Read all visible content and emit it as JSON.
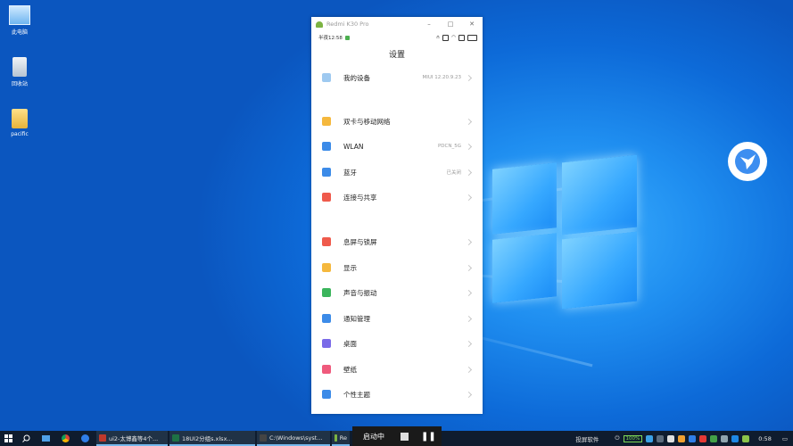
{
  "desktop": {
    "icons": [
      {
        "label": "此电脑"
      },
      {
        "label": "回收站"
      },
      {
        "label": "pacific"
      }
    ]
  },
  "phone": {
    "window_title": "Redmi K30 Pro",
    "status_time": "半夜12:58",
    "page_title": "设置",
    "items": [
      {
        "label": "我的设备",
        "value": "MIUI 12.20.9.23",
        "icon_color": "#9ec9f0",
        "icon": "device-icon"
      },
      {
        "label": "双卡与移动网络",
        "value": "",
        "icon_color": "#f5b83d",
        "icon": "sim-icon"
      },
      {
        "label": "WLAN",
        "value": "PDCN_5G",
        "icon_color": "#3c8be8",
        "icon": "wifi-icon"
      },
      {
        "label": "蓝牙",
        "value": "已关闭",
        "icon_color": "#3c8be8",
        "icon": "bluetooth-icon"
      },
      {
        "label": "连接与共享",
        "value": "",
        "icon_color": "#ef5a4c",
        "icon": "share-icon"
      },
      {
        "label": "息屏与锁屏",
        "value": "",
        "icon_color": "#ef5a4c",
        "icon": "lock-icon"
      },
      {
        "label": "显示",
        "value": "",
        "icon_color": "#f5b83d",
        "icon": "display-icon"
      },
      {
        "label": "声音与振动",
        "value": "",
        "icon_color": "#3bb55c",
        "icon": "sound-icon"
      },
      {
        "label": "通知管理",
        "value": "",
        "icon_color": "#3c8be8",
        "icon": "notification-icon"
      },
      {
        "label": "桌面",
        "value": "",
        "icon_color": "#7a6ae8",
        "icon": "home-icon"
      },
      {
        "label": "壁纸",
        "value": "",
        "icon_color": "#ef5a7c",
        "icon": "wallpaper-icon"
      },
      {
        "label": "个性主题",
        "value": "",
        "icon_color": "#3c8be8",
        "icon": "theme-icon"
      }
    ]
  },
  "taskbar": {
    "tasks": [
      {
        "label": "ui2-太博鑫等4个...",
        "icon_color": "#c0392b"
      },
      {
        "label": "18UI2分组s.xlsx...",
        "icon_color": "#1e7145"
      },
      {
        "label": "C:\\Windows\\syst...",
        "icon_color": "#444444"
      },
      {
        "label": "Re",
        "icon_color": "#7cb342"
      }
    ],
    "recording": {
      "status": "启动中"
    },
    "behind_text": "投屏软件",
    "battery": "100%",
    "clock": "0:58"
  }
}
